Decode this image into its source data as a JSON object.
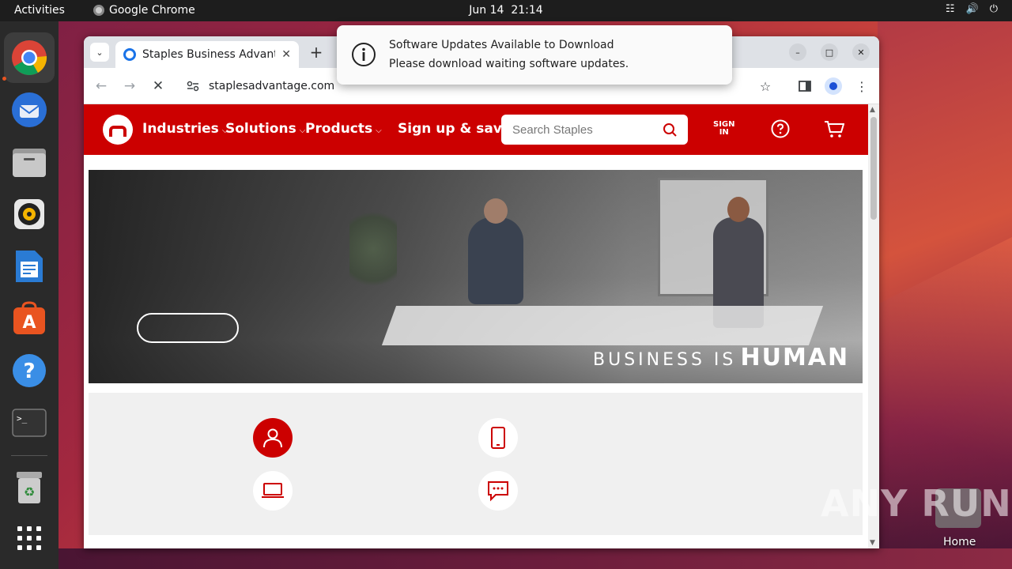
{
  "topbar": {
    "activities": "Activities",
    "app_name": "Google Chrome",
    "date": "Jun 14",
    "time": "21:14"
  },
  "dock": {
    "items": [
      "chrome-icon",
      "thunderbird-icon",
      "files-icon",
      "rhythmbox-icon",
      "writer-icon",
      "software-icon",
      "help-icon",
      "terminal-icon",
      "trash-icon",
      "apps-grid-icon"
    ]
  },
  "browser": {
    "tab_title": "Staples Business Advant",
    "url": "staplesadvantage.com",
    "new_tab": "+"
  },
  "site": {
    "nav": {
      "industries": "Industries",
      "solutions": "Solutions",
      "products": "Products",
      "signup": "Sign up & save"
    },
    "search_placeholder": "Search Staples",
    "signin_line1": "SIGN",
    "signin_line2": "IN",
    "hero_tagline_1": "BUSINESS IS",
    "hero_tagline_2": "HUMAN",
    "accent_color": "#cc0000"
  },
  "notification": {
    "title": "Software Updates Available to Download",
    "body": "Please download waiting software updates."
  },
  "desktop": {
    "home_label": "Home",
    "watermark": "ANY RUN"
  }
}
